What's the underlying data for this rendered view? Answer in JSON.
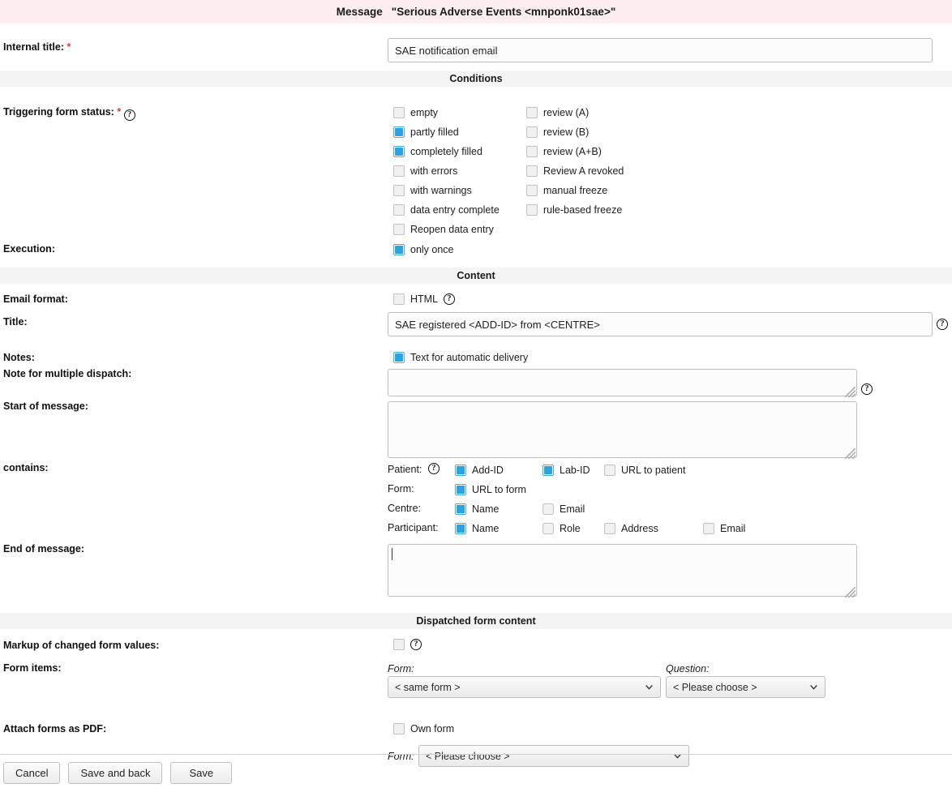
{
  "titlebar": {
    "label": "Message",
    "value": "\"Serious Adverse Events <mnponk01sae>\""
  },
  "internal_title": {
    "label": "Internal title:",
    "required_mark": "*",
    "value": "SAE notification email"
  },
  "sections": {
    "conditions": "Conditions",
    "content": "Content",
    "dispatched": "Dispatched form content"
  },
  "conditions": {
    "trigger_label": "Triggering form status:",
    "required_mark": "*",
    "help": "?",
    "column_left": [
      {
        "label": "empty",
        "checked": false
      },
      {
        "label": "partly filled",
        "checked": true
      },
      {
        "label": "completely filled",
        "checked": true
      },
      {
        "label": "with errors",
        "checked": false
      },
      {
        "label": "with warnings",
        "checked": false
      },
      {
        "label": "data entry complete",
        "checked": false
      },
      {
        "label": "Reopen data entry",
        "checked": false
      }
    ],
    "column_right": [
      {
        "label": "review (A)",
        "checked": false
      },
      {
        "label": "review (B)",
        "checked": false
      },
      {
        "label": "review (A+B)",
        "checked": false
      },
      {
        "label": "Review A revoked",
        "checked": false
      },
      {
        "label": "manual freeze",
        "checked": false
      },
      {
        "label": "rule-based freeze",
        "checked": false
      }
    ],
    "execution_label": "Execution:",
    "execution": {
      "label": "only once",
      "checked": true
    }
  },
  "content": {
    "email_format_label": "Email format:",
    "html": {
      "label": "HTML",
      "checked": false,
      "help": "?"
    },
    "title_label": "Title:",
    "title_value": "SAE registered <ADD-ID> from <CENTRE>",
    "title_help": "?",
    "notes_label": "Notes:",
    "notes_checkbox": {
      "label": "Text for automatic delivery",
      "checked": true
    },
    "multi_dispatch_label": "Note for multiple dispatch:",
    "multi_dispatch_value": "",
    "multi_dispatch_help": "?",
    "start_label": "Start of message:",
    "start_value": "",
    "contains_label": "contains:",
    "contains_help": "?",
    "contains_groups": [
      {
        "group": "Patient:",
        "items": [
          {
            "label": "Add-ID",
            "checked": true
          },
          {
            "label": "Lab-ID",
            "checked": true
          },
          {
            "label": "URL to patient",
            "checked": false
          }
        ]
      },
      {
        "group": "Form:",
        "items": [
          {
            "label": "URL to form",
            "checked": true
          }
        ]
      },
      {
        "group": "Centre:",
        "items": [
          {
            "label": "Name",
            "checked": true
          },
          {
            "label": "Email",
            "checked": false
          }
        ]
      },
      {
        "group": "Participant:",
        "items": [
          {
            "label": "Name",
            "checked": true
          },
          {
            "label": "Role",
            "checked": false
          },
          {
            "label": "Address",
            "checked": false
          },
          {
            "label": "Email",
            "checked": false
          }
        ]
      }
    ],
    "end_label": "End of message:",
    "end_value": ""
  },
  "dispatched": {
    "markup_label": "Markup of changed form values:",
    "markup_checked": false,
    "markup_help": "?",
    "form_items_label": "Form items:",
    "form_sublabel": "Form:",
    "form_select_value": "< same form >",
    "question_sublabel": "Question:",
    "question_select_value": "< Please choose >",
    "attach_label": "Attach forms as PDF:",
    "own_form": {
      "label": "Own form",
      "checked": false
    },
    "attach_form_sublabel": "Form:",
    "attach_form_select_value": "< Please choose >"
  },
  "footer": {
    "cancel": "Cancel",
    "save_and_back": "Save and back",
    "save": "Save"
  },
  "icons": {
    "help": "help-circle-icon",
    "chevron": "chevron-down-icon"
  },
  "colors": {
    "titlebar_bg": "#fceeee",
    "section_bg": "#f4f4f4",
    "checkbox_accent": "#29a3e3",
    "required": "#d63a3a"
  }
}
